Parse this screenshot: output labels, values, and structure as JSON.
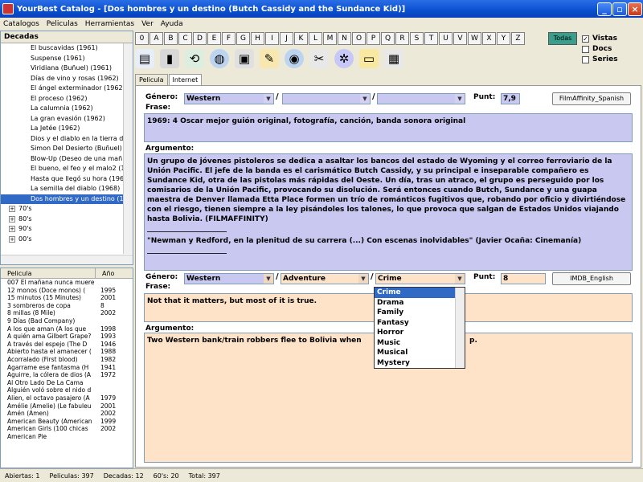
{
  "window": {
    "title": "YourBest Catalog - [Dos hombres y un destino (Butch Cassidy and the Sundance Kid)]"
  },
  "menu": [
    "Catalogos",
    "Peliculas",
    "Herramientas",
    "Ver",
    "Ayuda"
  ],
  "tree": {
    "header": "Decadas",
    "items": [
      "El buscavidas (1961)",
      "Suspense (1961)",
      "Viridiana (Buñuel) (1961)",
      "Días de vino y rosas (1962)",
      "El ángel exterminador (1962)",
      "El proceso (1962)",
      "La calumnia (1962)",
      "La gran evasión (1962)",
      "La Jetée (1962)",
      "Dios y el diablo en la tierra del",
      "Simon Del Desierto (Buñuel) (1",
      "Blow-Up (Deseo de una mañ",
      "El bueno, el feo y el malo2 (19",
      "Hasta que llegó su hora (1968",
      "La semilla del diablo (1968)",
      "Dos hombres y un destino (19"
    ],
    "decades": [
      "70's",
      "80's",
      "90's",
      "00's"
    ]
  },
  "list": {
    "col_title": "Pelicula",
    "col_year": "Año",
    "rows": [
      [
        "007 El mañana nunca muere",
        ""
      ],
      [
        "12 monos (Doce monos) (",
        "1995"
      ],
      [
        "15 minutos (15 Minutes)",
        "2001"
      ],
      [
        "3 sombreros de copa",
        "8"
      ],
      [
        "8 millas (8 Mile)",
        "2002"
      ],
      [
        "9 Días (Bad Company)",
        ""
      ],
      [
        "A los que aman (A los que",
        "1998"
      ],
      [
        "A quién ama Gilbert Grape?",
        "1993"
      ],
      [
        "A través del espejo (The D",
        "1946"
      ],
      [
        "Abierto hasta el amanecer (",
        "1988"
      ],
      [
        "Acorralado (First blood)",
        "1982"
      ],
      [
        "Agarrame ese fantasma (H",
        "1941"
      ],
      [
        "Aguirre, la cólera de dios (A",
        "1972"
      ],
      [
        "Al Otro Lado De La Cama",
        ""
      ],
      [
        "Alguién voló sobre el nido d",
        ""
      ],
      [
        "Alien, el octavo pasajero (A",
        "1979"
      ],
      [
        "Amélie (Amelie) (Le fabuleu",
        "2001"
      ],
      [
        "Amén (Amen)",
        "2002"
      ],
      [
        "American Beauty (American",
        "1999"
      ],
      [
        "American Girls (100 chicas",
        "2002"
      ],
      [
        "American Pie",
        ""
      ]
    ]
  },
  "alphabet": [
    "0",
    "A",
    "B",
    "C",
    "D",
    "E",
    "F",
    "G",
    "H",
    "I",
    "J",
    "K",
    "L",
    "M",
    "N",
    "O",
    "P",
    "Q",
    "R",
    "S",
    "T",
    "U",
    "V",
    "W",
    "X",
    "Y",
    "Z"
  ],
  "todas": "Todas",
  "checks": [
    {
      "label": "Vistas",
      "checked": true
    },
    {
      "label": "Docs",
      "checked": false
    },
    {
      "label": "Series",
      "checked": false
    }
  ],
  "tabs": [
    "Pelicula",
    "Internet"
  ],
  "filmaffinity": {
    "genero_label": "Género:",
    "genres": [
      "Western",
      "",
      ""
    ],
    "punt_label": "Punt:",
    "punt": "7,9",
    "button": "FilmAffinity_Spanish",
    "frase_label": "Frase:",
    "frase": "1969: 4 Oscar mejor guión original, fotografía, canción, banda sonora original",
    "argumento_label": "Argumento:",
    "argumento": "Un grupo de jóvenes pistoleros se dedica a asaltar los bancos del estado de Wyoming y el correo ferroviario de la Unión Pacific. El jefe de la banda es el carismático Butch Cassidy, y su principal e inseparable compañero es Sundance Kid, otra de las pistolas más rápidas del Oeste. Un día, tras un atraco, el grupo es perseguido por los comisarios de la Unión Pacific, provocando su disolución. Será entonces cuando Butch, Sundance y una guapa maestra de Denver llamada Etta Place formen un trío de románticos fugitivos que, robando por oficio y divirtiéndose con el riesgo, tienen siempre a la ley pisándoles los talones, lo que provoca que salgan de Estados Unidos viajando hasta Bolivia. (FILMAFFINITY)",
    "rule1": "______________________",
    "quote": "\"Newman y Redford, en la plenitud de su carrera (...) Con escenas inolvidables\" (Javier Ocaña: Cinemanía)",
    "rule2": "______________________"
  },
  "imdb": {
    "genero_label": "Género:",
    "genres": [
      "Western",
      "Adventure",
      "Crime"
    ],
    "punt_label": "Punt:",
    "punt": "8",
    "button": "IMDB_English",
    "frase_label": "Frase:",
    "frase": "Not that it matters, but most of it is true.",
    "argumento_label": "Argumento:",
    "argumento_start": "Two Western bank/train robbers flee to Bolivia when",
    "argumento_end": "p."
  },
  "dropdown": [
    "Crime",
    "Drama",
    "Family",
    "Fantasy",
    "Horror",
    "Music",
    "Musical",
    "Mystery"
  ],
  "status": [
    "Abiertas: 1",
    "Peliculas: 397",
    "Decadas: 12",
    "60's: 20",
    "Total: 397"
  ],
  "colors": {
    "title_bar": "#0a4fd0",
    "selection": "#316ac5",
    "blue_field": "#c8c8f0",
    "orange_field": "#ffe3c8"
  }
}
